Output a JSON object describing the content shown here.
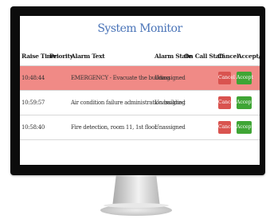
{
  "title": "System Monitor",
  "columns": [
    "Raise Time",
    "Priority",
    "Alarm Text",
    "Alarm State",
    "On Call Staff",
    "Cancel",
    "Accept/Close"
  ],
  "rows": [
    {
      "time": "10:48:44",
      "priority": "",
      "text": "EMERGENCY - Evacuate the building",
      "state": "Unassigned",
      "staff": "",
      "cancel_label": "Cancel",
      "accept_label": "Accept",
      "highlight": true
    },
    {
      "time": "10:59:57",
      "priority": "",
      "text": "Air condition failure administration building",
      "state": "Unassigned",
      "staff": "",
      "cancel_label": "Cancel",
      "accept_label": "Accept",
      "highlight": false
    },
    {
      "time": "10:58:40",
      "priority": "",
      "text": "Fire detection, room 11, 1st floor",
      "state": "Unassigned",
      "staff": "",
      "cancel_label": "Cancel",
      "accept_label": "Accept",
      "highlight": false
    }
  ],
  "colors": {
    "alarm_row": "#f08a86",
    "cancel": "#d9534f",
    "accept": "#3fa535",
    "title": "#4a74b8",
    "bezel": "#0c0c0c"
  },
  "icons": [
    "monitor-stand"
  ]
}
